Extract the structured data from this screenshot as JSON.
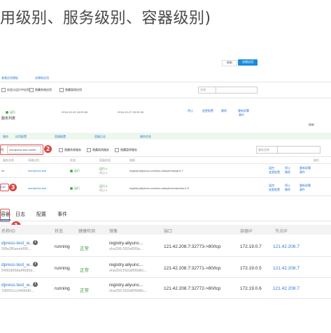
{
  "slide_title": "用级别、服务级别、容器级别)",
  "top_panel": {
    "btn_refresh": "刷新",
    "btn_create": "创建应用",
    "links": [
      "查看应用模板",
      "创建新应用"
    ],
    "filter_label": "仅显示运行中应用",
    "filter_opts": [
      "隐藏系统应用",
      "隐藏离线应用"
    ],
    "search_placeholder": "名称",
    "row": {
      "status": "运行",
      "created": "2016-10-24 18:03:08",
      "updated": "2016-10-27 09:30:26",
      "actions": [
        "停止",
        "变更配置",
        "删除",
        "重新部署"
      ],
      "more": "事件"
    },
    "section_title": "服务列表",
    "refresh2": "刷新"
  },
  "mid_panel": {
    "breadcrumb": [
      "服务",
      "应用配置",
      "容器配置",
      "容器日志",
      "资源监控",
      "日志",
      "事件",
      "服务信息"
    ],
    "select_value": "wordpress-test-online",
    "filter_opts": [
      "隐藏系统服务",
      "隐藏离线服务",
      "隐藏暂停服务"
    ],
    "search_placeholder": "服务名称",
    "col_headers": [
      "服务名称",
      "所属应用",
      "状态",
      "容器状态",
      "镜像",
      "操作"
    ],
    "rows": [
      {
        "name": "db",
        "app": "wordpress-test",
        "status": "运行",
        "count": "运行:1",
        "count2": "停止:0",
        "image": "registry.aliyuncs.com/acs-sample/mysql:5.7",
        "actions": [
          "监控",
          "停止",
          "重新部署",
          "变更配置",
          "删除",
          "事件"
        ]
      },
      {
        "name": "web",
        "app": "wordpress-test",
        "status": "运行",
        "count": "运行:3",
        "count2": "停止:0",
        "image": "registry.aliyuncs.com/acs-sample/wordpress:4.5",
        "actions": [
          "监控",
          "停止",
          "重新部署",
          "变更配置",
          "删除",
          "事件"
        ]
      }
    ]
  },
  "annotations": [
    "1",
    "2",
    "3"
  ],
  "tabs": [
    "容器",
    "日志",
    "配置",
    "事件"
  ],
  "table": {
    "headers": [
      "名称/ID",
      "状态",
      "健康检测",
      "镜像",
      "端口",
      "容器IP",
      "节点IP"
    ],
    "rows": [
      {
        "name": "dpress-test_w...",
        "id": "59fa2f6aeeb6f5...",
        "status": "running",
        "health": "正常",
        "image": "registry.aliyunc...",
        "image_sha": "sha256:592af5f9a...",
        "port": "121.42.208.7:32773->80/tcp",
        "container_ip": "172.19.0.7",
        "node_ip": "121.42.208.7"
      },
      {
        "name": "dpress-test_w...",
        "id": "5490d858a4f9d5d...",
        "status": "running",
        "health": "正常",
        "image": "registry.aliyunc...",
        "image_sha": "sha256:592af5f9d6c...",
        "port": "121.42.208.7:32771->80/tcp",
        "container_ip": "172.19.0.5",
        "node_ip": "121.42.208.7"
      },
      {
        "name": "dpress-test_w...",
        "id": "7d5551cc9490d9...",
        "status": "running",
        "health": "正常",
        "image": "registry.aliyunc...",
        "image_sha": "sha256:592af5f9d6c...",
        "port": "121.42.208.7:32772->80/tcp",
        "container_ip": "172.19.0.6",
        "node_ip": "121.42.208.7"
      }
    ]
  },
  "colors": {
    "accent": "#1c8cdb",
    "running": "#3bb54a",
    "annotation": "#d9443f",
    "link": "#2a7ad5"
  }
}
